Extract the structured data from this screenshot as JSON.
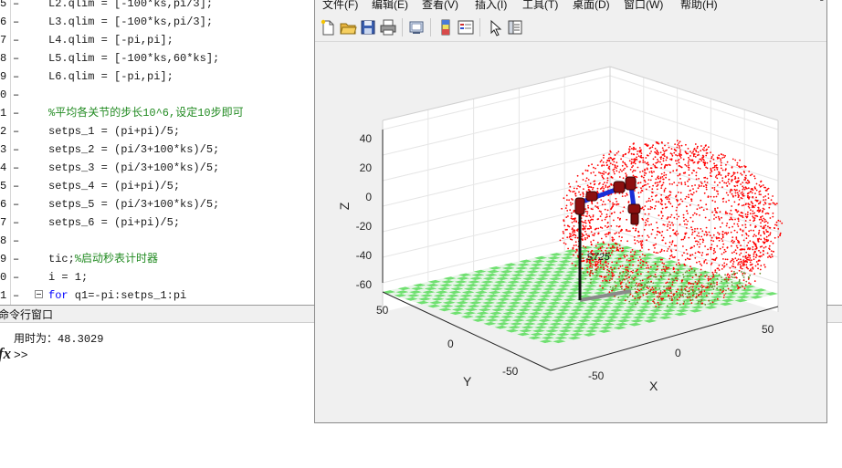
{
  "editor": {
    "lines": [
      {
        "num": "5",
        "text": "L2.qlim = [-100*ks,pi/3];",
        "style": "code"
      },
      {
        "num": "6",
        "text": "L3.qlim = [-100*ks,pi/3];",
        "style": "code"
      },
      {
        "num": "7",
        "text": "L4.qlim = [-pi,pi];",
        "style": "code"
      },
      {
        "num": "8",
        "text": "L5.qlim = [-100*ks,60*ks];",
        "style": "code"
      },
      {
        "num": "9",
        "text": "L6.qlim = [-pi,pi];",
        "style": "code"
      },
      {
        "num": "0",
        "text": "",
        "style": "code"
      },
      {
        "num": "1",
        "text": "%平均各关节的步长10^6,设定10步即可",
        "style": "comment"
      },
      {
        "num": "2",
        "text": "setps_1 = (pi+pi)/5;",
        "style": "code"
      },
      {
        "num": "3",
        "text": "setps_2 = (pi/3+100*ks)/5;",
        "style": "code"
      },
      {
        "num": "4",
        "text": "setps_3 = (pi/3+100*ks)/5;",
        "style": "code"
      },
      {
        "num": "5",
        "text": "setps_4 = (pi+pi)/5;",
        "style": "code"
      },
      {
        "num": "6",
        "text": "setps_5 = (pi/3+100*ks)/5;",
        "style": "code"
      },
      {
        "num": "7",
        "text": "setps_6 = (pi+pi)/5;",
        "style": "code"
      },
      {
        "num": "8",
        "text": "",
        "style": "code"
      },
      {
        "num": "9",
        "text": "tic;%启动秒表计时器",
        "style": "mixed",
        "code": "tic;",
        "comment": "%启动秒表计时器"
      },
      {
        "num": "0",
        "text": "i = 1;",
        "style": "code"
      },
      {
        "num": "1",
        "text": "for q1=-pi:setps_1:pi",
        "style": "for",
        "kw": "for",
        "rest": " q1=-pi:setps_1:pi"
      }
    ]
  },
  "command_window": {
    "title": "命令行窗口",
    "output_label": "用时为：",
    "output_value": "48.3029",
    "fx_label": "fx",
    "prompt": ">>"
  },
  "figure": {
    "menus": [
      "文件(F)",
      "编辑(E)",
      "查看(V)",
      "插入(I)",
      "工具(T)",
      "桌面(D)",
      "窗口(W)",
      "帮助(H)"
    ],
    "close_glyph": "↘",
    "toolbar_icons": [
      "new-figure-icon",
      "open-file-icon",
      "save-icon",
      "print-icon",
      "link-plot-icon",
      "insert-colorbar-icon",
      "insert-legend-icon",
      "pointer-icon",
      "property-inspector-icon"
    ],
    "axes": {
      "z_label": "Z",
      "y_label": "Y",
      "x_label": "X",
      "z_ticks": [
        "40",
        "20",
        "0",
        "-20",
        "-40",
        "-60"
      ],
      "y_ticks": [
        "50",
        "0",
        "-50"
      ],
      "x_ticks": [
        "-50",
        "0",
        "50"
      ],
      "robot_label": "S725"
    },
    "colors": {
      "points": "#ff0000",
      "floor_green": "#6fe070",
      "floor_light": "#e8f4e8",
      "link_blue": "#1a2fd6",
      "joint_red": "#8b1010"
    }
  }
}
